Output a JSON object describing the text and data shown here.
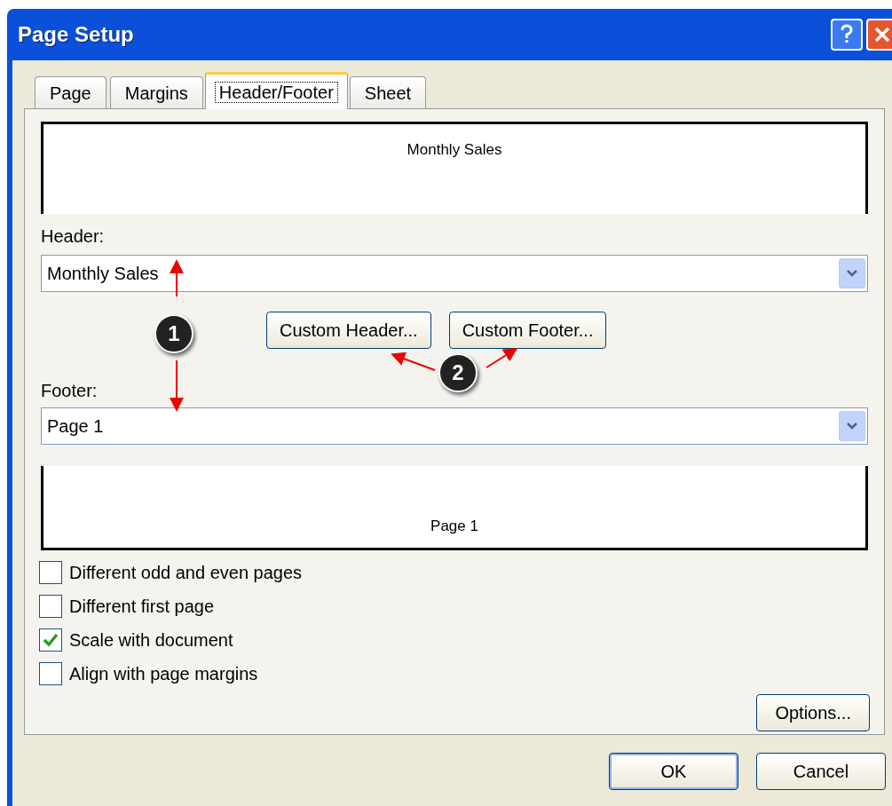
{
  "window": {
    "title": "Page Setup"
  },
  "tabs": [
    {
      "label": "Page",
      "selected": false
    },
    {
      "label": "Margins",
      "selected": false
    },
    {
      "label": "Header/Footer",
      "selected": true
    },
    {
      "label": "Sheet",
      "selected": false
    }
  ],
  "header_preview": {
    "text": "Monthly Sales"
  },
  "header": {
    "label": "Header:",
    "value": "Monthly Sales"
  },
  "custom_buttons": [
    "Custom Header...",
    "Custom Footer..."
  ],
  "footer": {
    "label": "Footer:",
    "value": "Page 1"
  },
  "footer_preview": {
    "text": "Page 1"
  },
  "options": [
    {
      "label": "Different odd and even pages",
      "checked": false
    },
    {
      "label": "Different first page",
      "checked": false
    },
    {
      "label": "Scale with document",
      "checked": true
    },
    {
      "label": "Align with page margins",
      "checked": false
    }
  ],
  "options_button": "Options...",
  "buttons": [
    {
      "label": "OK",
      "selected": true
    },
    {
      "label": "Cancel",
      "selected": false
    }
  ],
  "callouts": [
    {
      "label": "1"
    },
    {
      "label": "2"
    }
  ]
}
